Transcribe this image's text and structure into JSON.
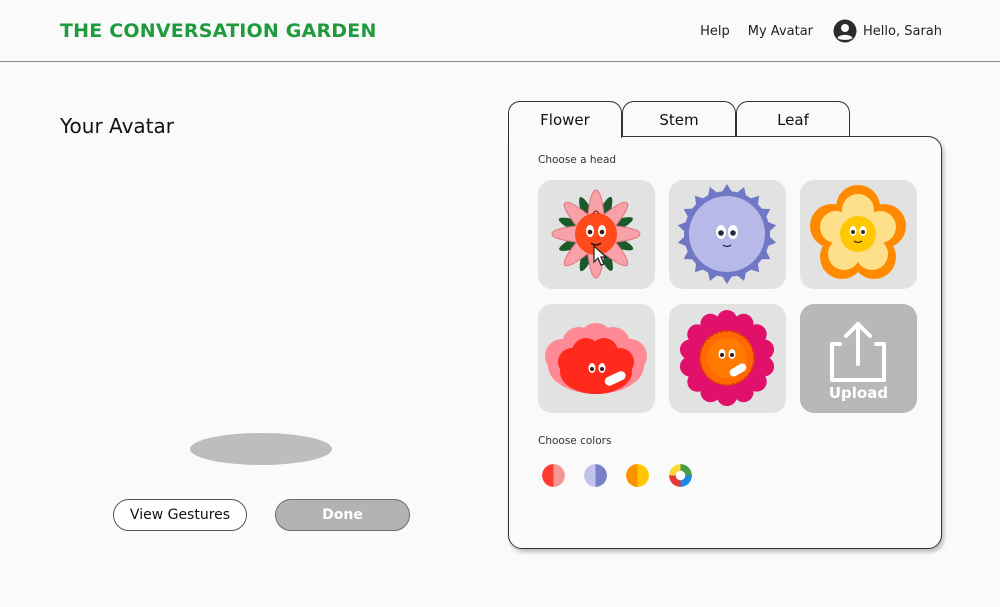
{
  "header": {
    "logo": "THE CONVERSATION GARDEN",
    "nav": {
      "help": "Help",
      "my_avatar": "My Avatar",
      "greeting": "Hello, Sarah"
    }
  },
  "left": {
    "title": "Your Avatar",
    "view_gestures_label": "View Gestures",
    "done_label": "Done"
  },
  "tabs": [
    {
      "label": "Flower",
      "active": true
    },
    {
      "label": "Stem",
      "active": false
    },
    {
      "label": "Leaf",
      "active": false
    }
  ],
  "panel": {
    "choose_head_label": "Choose a head",
    "heads": [
      {
        "name": "pink-daisy-head",
        "colors": [
          "#f7a1a8",
          "#ff4a1c",
          "#1a5a2a"
        ]
      },
      {
        "name": "blue-spiky-head",
        "colors": [
          "#b7b9e8",
          "#7077c5"
        ]
      },
      {
        "name": "orange-star-head",
        "colors": [
          "#ff8a00",
          "#ffe08a",
          "#ffc800"
        ]
      },
      {
        "name": "red-tulip-head",
        "colors": [
          "#ff6b73",
          "#ff2a1c"
        ]
      },
      {
        "name": "magenta-zinnia-head",
        "colors": [
          "#e0106b",
          "#ff6a00"
        ]
      }
    ],
    "upload_label": "Upload",
    "choose_colors_label": "Choose colors",
    "color_swatches": [
      {
        "name": "red-swatch",
        "colors": [
          "#ff3b30",
          "#f79696"
        ]
      },
      {
        "name": "blue-swatch",
        "colors": [
          "#7a80c8",
          "#c0c3ea"
        ]
      },
      {
        "name": "orange-swatch",
        "colors": [
          "#ff9000",
          "#ffc800"
        ]
      },
      {
        "name": "multicolor-swatch",
        "colors": [
          "#e53935",
          "#1e88e5",
          "#43a047",
          "#fdd835"
        ]
      }
    ]
  }
}
